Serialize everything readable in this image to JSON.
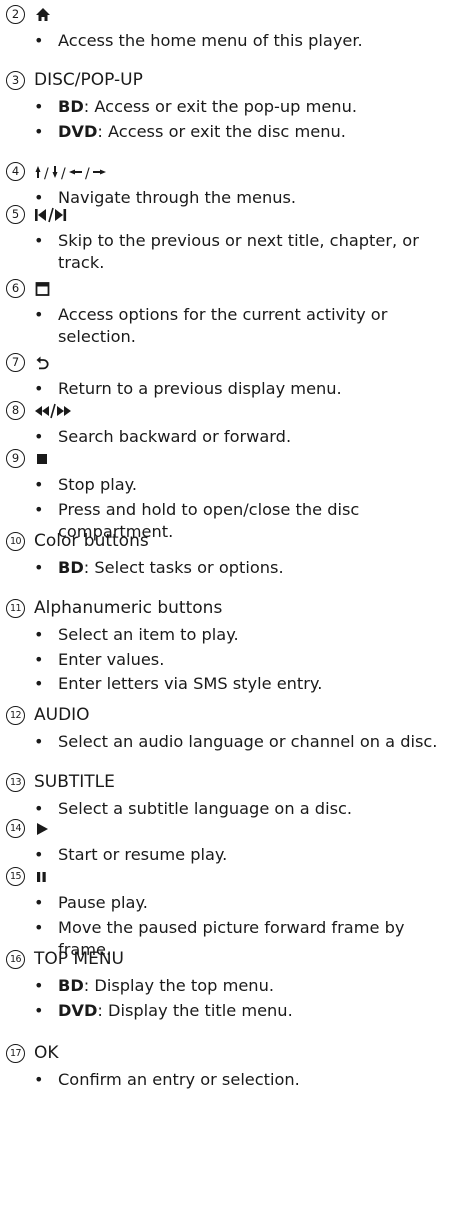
{
  "entries": [
    {
      "num": "2",
      "kind": "icon",
      "icon": "home-icon",
      "items": [
        {
          "text": "Access the home menu of this player."
        }
      ]
    },
    {
      "num": "3",
      "kind": "text",
      "heading": "DISC/POP-UP",
      "items": [
        {
          "bold": "BD",
          "text": ": Access or exit the pop-up menu."
        },
        {
          "bold": "DVD",
          "text": ": Access or exit the disc menu."
        }
      ]
    },
    {
      "num": "4",
      "kind": "icon",
      "icon": "navigation-arrows-icon",
      "items": [
        {
          "text": "Navigate through the menus."
        }
      ]
    },
    {
      "num": "5",
      "kind": "icon",
      "icon": "skip-previous-next-icon",
      "items": [
        {
          "text": "Skip to the previous or next title, chapter, or track."
        }
      ]
    },
    {
      "num": "6",
      "kind": "icon",
      "icon": "options-icon",
      "items": [
        {
          "text": "Access options for the current activity or selection."
        }
      ]
    },
    {
      "num": "7",
      "kind": "icon",
      "icon": "back-icon",
      "items": [
        {
          "text": "Return to a previous display menu."
        }
      ]
    },
    {
      "num": "8",
      "kind": "icon",
      "icon": "rewind-fast-forward-icon",
      "items": [
        {
          "text": "Search backward or forward."
        }
      ]
    },
    {
      "num": "9",
      "kind": "icon",
      "icon": "stop-icon",
      "items": [
        {
          "text": "Stop play."
        },
        {
          "text": "Press and hold to open/close the disc compartment."
        }
      ]
    },
    {
      "num": "10",
      "kind": "text",
      "heading": "Color buttons",
      "items": [
        {
          "bold": "BD",
          "text": ": Select tasks or options."
        }
      ]
    },
    {
      "num": "11",
      "kind": "text",
      "heading": "Alphanumeric buttons",
      "items": [
        {
          "text": "Select an item to play."
        },
        {
          "text": "Enter values."
        },
        {
          "text": "Enter letters via SMS style entry."
        }
      ]
    },
    {
      "num": "12",
      "kind": "text",
      "heading": "AUDIO",
      "items": [
        {
          "text": "Select an audio language or channel on a disc."
        }
      ]
    },
    {
      "num": "13",
      "kind": "text",
      "heading": "SUBTITLE",
      "items": [
        {
          "text": "Select a subtitle language on a disc."
        }
      ]
    },
    {
      "num": "14",
      "kind": "icon",
      "icon": "play-icon",
      "items": [
        {
          "text": "Start or resume play."
        }
      ]
    },
    {
      "num": "15",
      "kind": "icon",
      "icon": "pause-icon",
      "items": [
        {
          "text": "Pause play."
        },
        {
          "text": "Move the paused picture forward frame by frame."
        }
      ]
    },
    {
      "num": "16",
      "kind": "text",
      "heading": "TOP MENU",
      "items": [
        {
          "bold": "BD",
          "text": ": Display the top menu."
        },
        {
          "bold": "DVD",
          "text": ": Display the title menu."
        }
      ]
    },
    {
      "num": "17",
      "kind": "text",
      "heading": "OK",
      "items": [
        {
          "text": "Confirm an entry or selection."
        }
      ]
    }
  ]
}
